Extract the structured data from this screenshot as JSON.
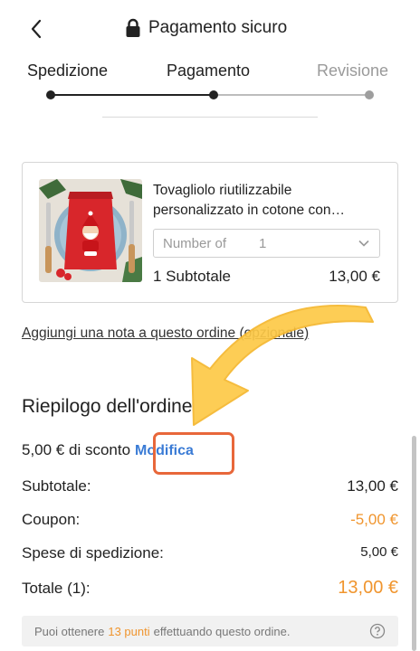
{
  "header": {
    "title": "Pagamento sicuro"
  },
  "steps": [
    {
      "label": "Spedizione",
      "state": "done"
    },
    {
      "label": "Pagamento",
      "state": "current"
    },
    {
      "label": "Revisione",
      "state": "todo"
    }
  ],
  "cart_item": {
    "name": "Tovagliolo riutilizzabile personalizzato in cotone con…",
    "quantity_placeholder": "Number of",
    "quantity_value": "1",
    "subtotal_label": "1 Subtotale",
    "subtotal_value": "13,00 €"
  },
  "add_note_link": "Aggiungi una nota a questo ordine (opzionale)",
  "summary": {
    "title": "Riepilogo dell'ordine",
    "discount_text": "5,00 € di sconto",
    "edit_label": "Modifica",
    "rows": [
      {
        "label": "Subtotale:",
        "value": "13,00 €"
      },
      {
        "label": "Coupon:",
        "value": "-5,00 €"
      },
      {
        "label": "Spese di spedizione:",
        "value": "5,00 €"
      },
      {
        "label": "Totale (1):",
        "value": "13,00 €"
      }
    ]
  },
  "points": {
    "prefix": "Puoi ottenere",
    "amount": "13 punti",
    "suffix": "effettuando questo ordine."
  },
  "colors": {
    "accent_orange": "#f0952e",
    "link_blue": "#3a7bd5",
    "highlight_box": "#e8673a",
    "arrow_yellow": "#fdc947"
  }
}
